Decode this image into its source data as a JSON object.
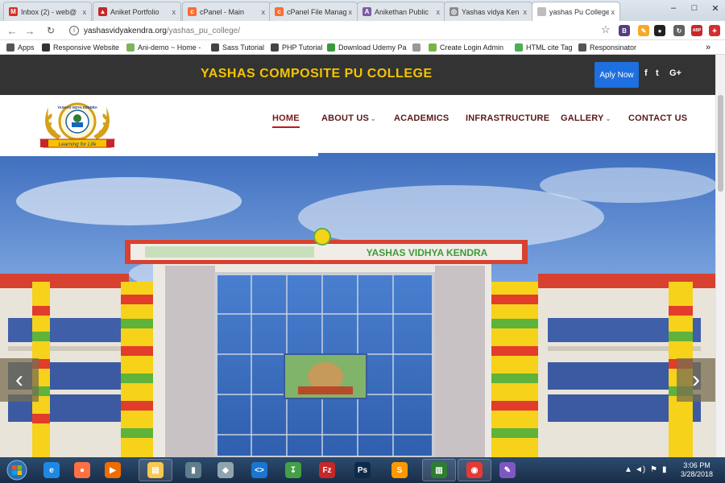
{
  "browser": {
    "tabs": [
      {
        "title": "Inbox (2) - web@",
        "icon": "gmail-icon",
        "color": "#d93025",
        "glyph": "M",
        "active": false
      },
      {
        "title": "Aniket Portfolio",
        "icon": "portfolio-icon",
        "color": "#c62828",
        "glyph": "▲",
        "active": false
      },
      {
        "title": "cPanel - Main",
        "icon": "cpanel-icon",
        "color": "#ff6c2c",
        "glyph": "c",
        "active": false
      },
      {
        "title": "cPanel File Manag",
        "icon": "cpanel-icon",
        "color": "#ff6c2c",
        "glyph": "c",
        "active": false
      },
      {
        "title": "Anikethan Public",
        "icon": "school-icon",
        "color": "#7a5ca8",
        "glyph": "A",
        "active": false
      },
      {
        "title": "Yashas vidya Ken",
        "icon": "globe-icon",
        "color": "#8a8a8a",
        "glyph": "◎",
        "active": false
      },
      {
        "title": "yashas Pu College",
        "icon": "page-icon",
        "color": "#bdbdbd",
        "glyph": "",
        "active": true
      }
    ],
    "close_glyph": "x",
    "new_tab_glyph": "",
    "window_controls": {
      "minimize": "–",
      "maximize": "□",
      "close": "✕"
    },
    "url_host": "yashasvidyakendra.org",
    "url_path": "/yashas_pu_college/",
    "bookmarks": [
      {
        "label": "Apps",
        "icon": "apps-grid-icon",
        "color": "#555"
      },
      {
        "label": "Responsive Website",
        "icon": "car-icon",
        "color": "#333"
      },
      {
        "label": "Ani-demo ~ Home -",
        "icon": "shopify-icon",
        "color": "#7ab55c"
      },
      {
        "label": "Sass Tutorial",
        "icon": "diamond-icon",
        "color": "#444"
      },
      {
        "label": "PHP Tutorial",
        "icon": "diamond-icon",
        "color": "#444"
      },
      {
        "label": "Download Udemy Pa",
        "icon": "ftu-icon",
        "color": "#3a9a3a"
      },
      {
        "label": "",
        "icon": "document-icon",
        "color": "#999"
      },
      {
        "label": "Create Login Admin",
        "icon": "yii-icon",
        "color": "#7cb342"
      },
      {
        "label": "HTML cite Tag",
        "icon": "w3schools-icon",
        "color": "#4caf50"
      },
      {
        "label": "Responsinator",
        "icon": "responsinator-icon",
        "color": "#555"
      }
    ],
    "bookmarks_overflow": "»",
    "extensions": [
      {
        "glyph": "B",
        "color": "#563d7c",
        "icon": "bootstrap-icon"
      },
      {
        "glyph": "✎",
        "color": "#f9a825",
        "icon": "colorpick-icon"
      },
      {
        "glyph": "●",
        "color": "#212121",
        "icon": "dark-ext-icon"
      },
      {
        "glyph": "↻",
        "color": "#616161",
        "icon": "refresh-ext-icon"
      },
      {
        "glyph": "ABP",
        "color": "#c62828",
        "icon": "adblock-icon"
      },
      {
        "glyph": "✦",
        "color": "#d32f2f",
        "icon": "ext-red-icon"
      }
    ]
  },
  "site": {
    "college_name": "YASHAS COMPOSITE PU COLLEGE",
    "apply_button": "Aply Now",
    "social": [
      "f",
      "t",
      "G+"
    ],
    "logo": {
      "ring_text": "YASHAS VIDYA KENDRA",
      "banner_text": "Learning for Life"
    },
    "nav": [
      {
        "label": "HOME",
        "active": true,
        "dropdown": false
      },
      {
        "label": "ABOUT US",
        "active": false,
        "dropdown": true
      },
      {
        "label": "ACADEMICS",
        "active": false,
        "dropdown": false
      },
      {
        "label": "INFRASTRUCTURE",
        "active": false,
        "dropdown": false
      },
      {
        "label": "GALLERY",
        "active": false,
        "dropdown": true
      },
      {
        "label": "CONTACT US",
        "active": false,
        "dropdown": false
      }
    ],
    "hero": {
      "building_sign": "YASHAS VIDHYA KENDRA",
      "prev_arrow": "‹",
      "next_arrow": "›"
    }
  },
  "taskbar": {
    "apps": [
      {
        "name": "ie",
        "icon": "internet-explorer-icon",
        "glyph": "e",
        "color": "#1e88e5"
      },
      {
        "name": "firefox",
        "icon": "firefox-icon",
        "glyph": "●",
        "color": "#ff7043"
      },
      {
        "name": "media",
        "icon": "media-player-icon",
        "glyph": "▶",
        "color": "#ef6c00"
      },
      {
        "name": "explorer",
        "icon": "file-explorer-icon",
        "glyph": "▤",
        "color": "#f9c74f",
        "running": true
      },
      {
        "name": "device",
        "icon": "device-icon",
        "glyph": "▮",
        "color": "#607d8b"
      },
      {
        "name": "virtualbox",
        "icon": "box-icon",
        "glyph": "◆",
        "color": "#90a4ae"
      },
      {
        "name": "vscode",
        "icon": "vscode-icon",
        "glyph": "<>",
        "color": "#1976d2"
      },
      {
        "name": "filezilla-alt",
        "icon": "download-arrow-icon",
        "glyph": "↧",
        "color": "#43a047"
      },
      {
        "name": "filezilla",
        "icon": "filezilla-icon",
        "glyph": "Fz",
        "color": "#c62828"
      },
      {
        "name": "photoshop",
        "icon": "photoshop-icon",
        "glyph": "Ps",
        "color": "#0d2a4a"
      },
      {
        "name": "sublime",
        "icon": "sublime-icon",
        "glyph": "S",
        "color": "#ff9800"
      },
      {
        "name": "excel",
        "icon": "spreadsheet-icon",
        "glyph": "▥",
        "color": "#2e7d32",
        "running": true
      },
      {
        "name": "chrome",
        "icon": "chrome-icon",
        "glyph": "◉",
        "color": "#e53935",
        "running": true
      },
      {
        "name": "paint",
        "icon": "paint-icon",
        "glyph": "✎",
        "color": "#7e57c2"
      }
    ],
    "tray_icons": [
      "▲",
      "◄)",
      "⚑",
      "▮"
    ],
    "time": "3:06 PM",
    "date": "3/28/2018"
  }
}
